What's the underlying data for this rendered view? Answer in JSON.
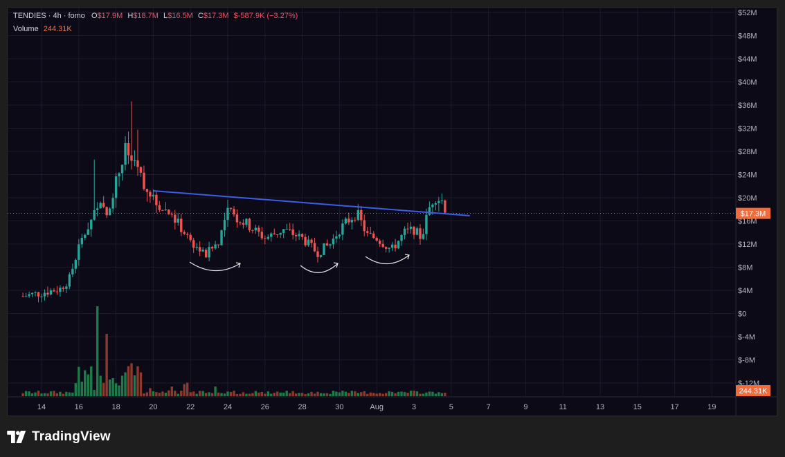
{
  "legend": {
    "symbol": "TENDIES · 4h · fomo",
    "open_label": "O",
    "open_value": "$17.9M",
    "high_label": "H",
    "high_value": "$18.7M",
    "low_label": "L",
    "low_value": "$16.5M",
    "close_label": "C",
    "close_value": "$17.3M",
    "change_value": "$-587.9K (−3.27%)",
    "volume_label": "Volume",
    "volume_value": "244.31K"
  },
  "price_badge": "$17.3M",
  "volume_badge": "244.31K",
  "brand": {
    "name": "TradingView"
  },
  "colors": {
    "up": "#26a69a",
    "down": "#ef5350",
    "up_volume": "#1f7a4a",
    "down_volume": "#8c3a2e",
    "trendline": "#3d5ce8",
    "badge": "#f26b3c",
    "background": "#0d0a17"
  },
  "chart_data": {
    "type": "candlestick",
    "y_axis": {
      "ticks": [
        "$52M",
        "$48M",
        "$44M",
        "$40M",
        "$36M",
        "$32M",
        "$28M",
        "$24M",
        "$20M",
        "$16M",
        "$12M",
        "$8M",
        "$4M",
        "$0",
        "$-4M",
        "$-8M",
        "$-12M"
      ],
      "range_millions": [
        -12.5,
        52.5
      ]
    },
    "x_axis": {
      "ticks": [
        "14",
        "16",
        "18",
        "20",
        "22",
        "24",
        "26",
        "28",
        "30",
        "Aug",
        "3",
        "5",
        "7",
        "9",
        "11",
        "13",
        "15",
        "17",
        "19"
      ]
    },
    "current_price_millions": 17.3,
    "trendline_millions": {
      "start_date": "Jul 20",
      "start": 21.2,
      "end_date": "Aug 6",
      "end": 16.9
    },
    "annotations": [
      "rounded-bottom-arrow",
      "rounded-bottom-arrow",
      "rounded-bottom-arrow"
    ],
    "price_path_millions": [
      {
        "date": "Jul 13",
        "value": 3.0
      },
      {
        "date": "Jul 14",
        "value": 3.6
      },
      {
        "date": "Jul 15",
        "value": 4.3
      },
      {
        "date": "Jul 15.5",
        "value": 6.0
      },
      {
        "date": "Jul 16",
        "value": 11.5
      },
      {
        "date": "Jul 16.5",
        "value": 15.0
      },
      {
        "date": "Jul 17",
        "value": 19.0
      },
      {
        "date": "Jul 17.5",
        "value": 17.0
      },
      {
        "date": "Jul 18",
        "value": 23.0
      },
      {
        "date": "Jul 18.5",
        "value": 28.0
      },
      {
        "date": "Jul 19",
        "value": 26.0
      },
      {
        "date": "Jul 19.5",
        "value": 22.5
      },
      {
        "date": "Jul 20",
        "value": 19.5
      },
      {
        "date": "Jul 21",
        "value": 17.0
      },
      {
        "date": "Jul 22",
        "value": 12.5
      },
      {
        "date": "Jul 22.8",
        "value": 10.0
      },
      {
        "date": "Jul 23.5",
        "value": 12.5
      },
      {
        "date": "Jul 24",
        "value": 17.5
      },
      {
        "date": "Jul 24.5",
        "value": 16.5
      },
      {
        "date": "Jul 25",
        "value": 15.5
      },
      {
        "date": "Jul 26",
        "value": 13.0
      },
      {
        "date": "Jul 27",
        "value": 14.5
      },
      {
        "date": "Jul 28",
        "value": 13.0
      },
      {
        "date": "Jul 28.8",
        "value": 10.5
      },
      {
        "date": "Jul 29.5",
        "value": 12.0
      },
      {
        "date": "Jul 30",
        "value": 14.5
      },
      {
        "date": "Jul 30.9",
        "value": 17.5
      },
      {
        "date": "Jul 31.5",
        "value": 13.5
      },
      {
        "date": "Aug 1",
        "value": 13.0
      },
      {
        "date": "Aug 1.8",
        "value": 11.0
      },
      {
        "date": "Aug 2.5",
        "value": 14.0
      },
      {
        "date": "Aug 3",
        "value": 14.5
      },
      {
        "date": "Aug 3.4",
        "value": 13.0
      },
      {
        "date": "Aug 3.8",
        "value": 18.0
      },
      {
        "date": "Aug 4.1",
        "value": 20.5
      },
      {
        "date": "Aug 4.5",
        "value": 19.5
      },
      {
        "date": "Aug 4.8",
        "value": 17.3
      }
    ]
  }
}
